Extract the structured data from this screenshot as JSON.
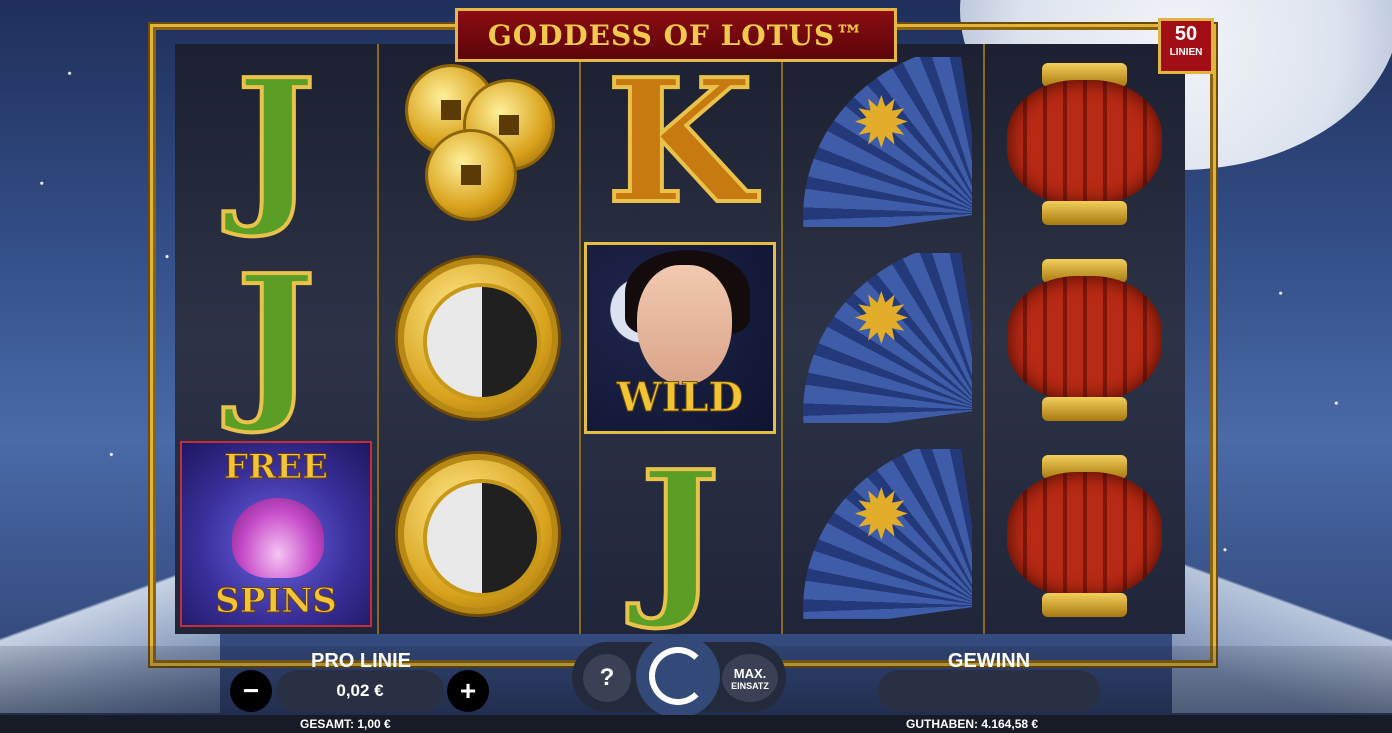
{
  "game": {
    "title": "GODDESS OF LOTUS™",
    "lines_count": "50",
    "lines_label": "LINIEN"
  },
  "reels": [
    [
      "J",
      "J",
      "FREE SPINS"
    ],
    [
      "coins",
      "yin-yang",
      "yin-yang"
    ],
    [
      "K",
      "WILD",
      "J"
    ],
    [
      "fan",
      "fan",
      "fan"
    ],
    [
      "lantern",
      "lantern",
      "lantern"
    ]
  ],
  "symbols": {
    "wild_label": "WILD",
    "scatter_top": "FREE",
    "scatter_bottom": "SPINS"
  },
  "controls": {
    "pro_linie_label": "PRO LINIE",
    "pro_linie_value": "0,02 €",
    "minus": "−",
    "plus": "+",
    "help": "?",
    "max_line1": "MAX.",
    "max_line2": "EINSATZ",
    "gewinn_label": "GEWINN",
    "gewinn_value": "",
    "gesamt": "GESAMT: 1,00 €",
    "guthaben": "GUTHABEN: 4.164,58 €"
  }
}
